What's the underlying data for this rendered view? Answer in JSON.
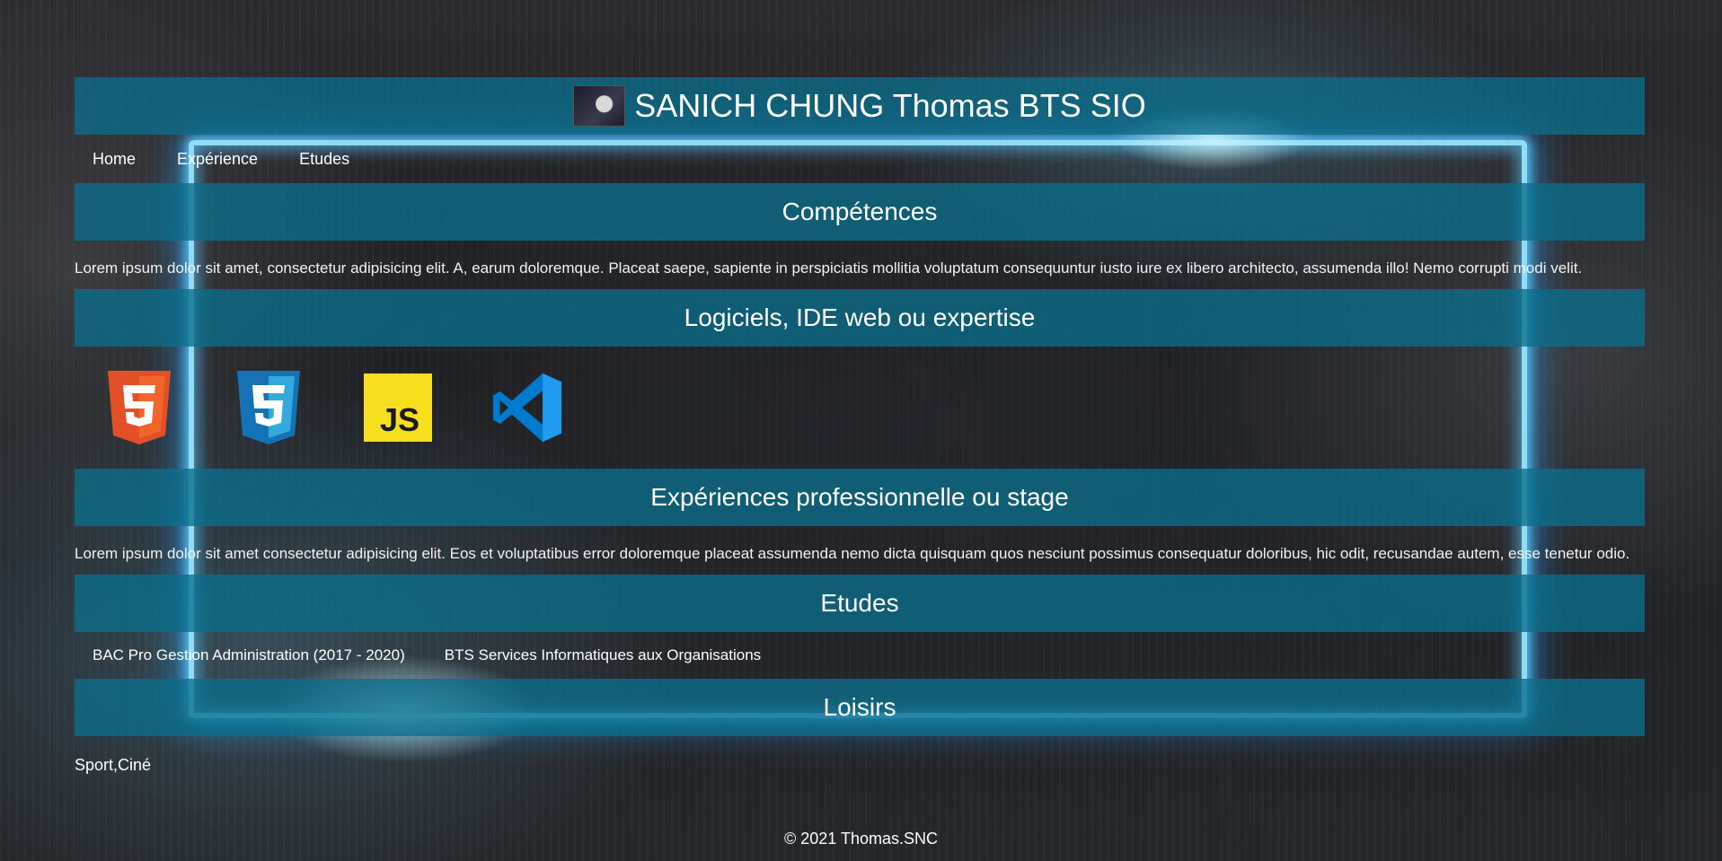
{
  "header": {
    "title": "SANICH CHUNG Thomas BTS SIO"
  },
  "nav": {
    "items": [
      "Home",
      "Expérience",
      "Etudes"
    ]
  },
  "sections": {
    "competences": {
      "title": "Compétences",
      "text": "Lorem ipsum dolor sit amet, consectetur adipisicing elit. A, earum doloremque. Placeat saepe, sapiente in perspiciatis mollitia voluptatum consequuntur iusto iure ex libero architecto, assumenda illo! Nemo corrupti modi velit."
    },
    "logiciels": {
      "title": "Logiciels, IDE web ou expertise",
      "logos": [
        "html5-icon",
        "css3-icon",
        "javascript-icon",
        "vscode-icon"
      ]
    },
    "experiences": {
      "title": "Expériences professionnelle ou stage",
      "text": "Lorem ipsum dolor sit amet consectetur adipisicing elit. Eos et voluptatibus error doloremque placeat assumenda nemo dicta quisquam quos nesciunt possimus consequatur doloribus, hic odit, recusandae autem, esse tenetur odio."
    },
    "etudes": {
      "title": "Etudes",
      "links": [
        "BAC Pro Gestion Administration (2017 - 2020)",
        "BTS Services Informatiques aux Organisations"
      ]
    },
    "loisirs": {
      "title": "Loisirs",
      "text": "Sport,Ciné"
    }
  },
  "footer": {
    "text": "© 2021 Thomas.SNC"
  },
  "colors": {
    "bar": "#0a6e8c",
    "neon": "#96e6ff"
  }
}
